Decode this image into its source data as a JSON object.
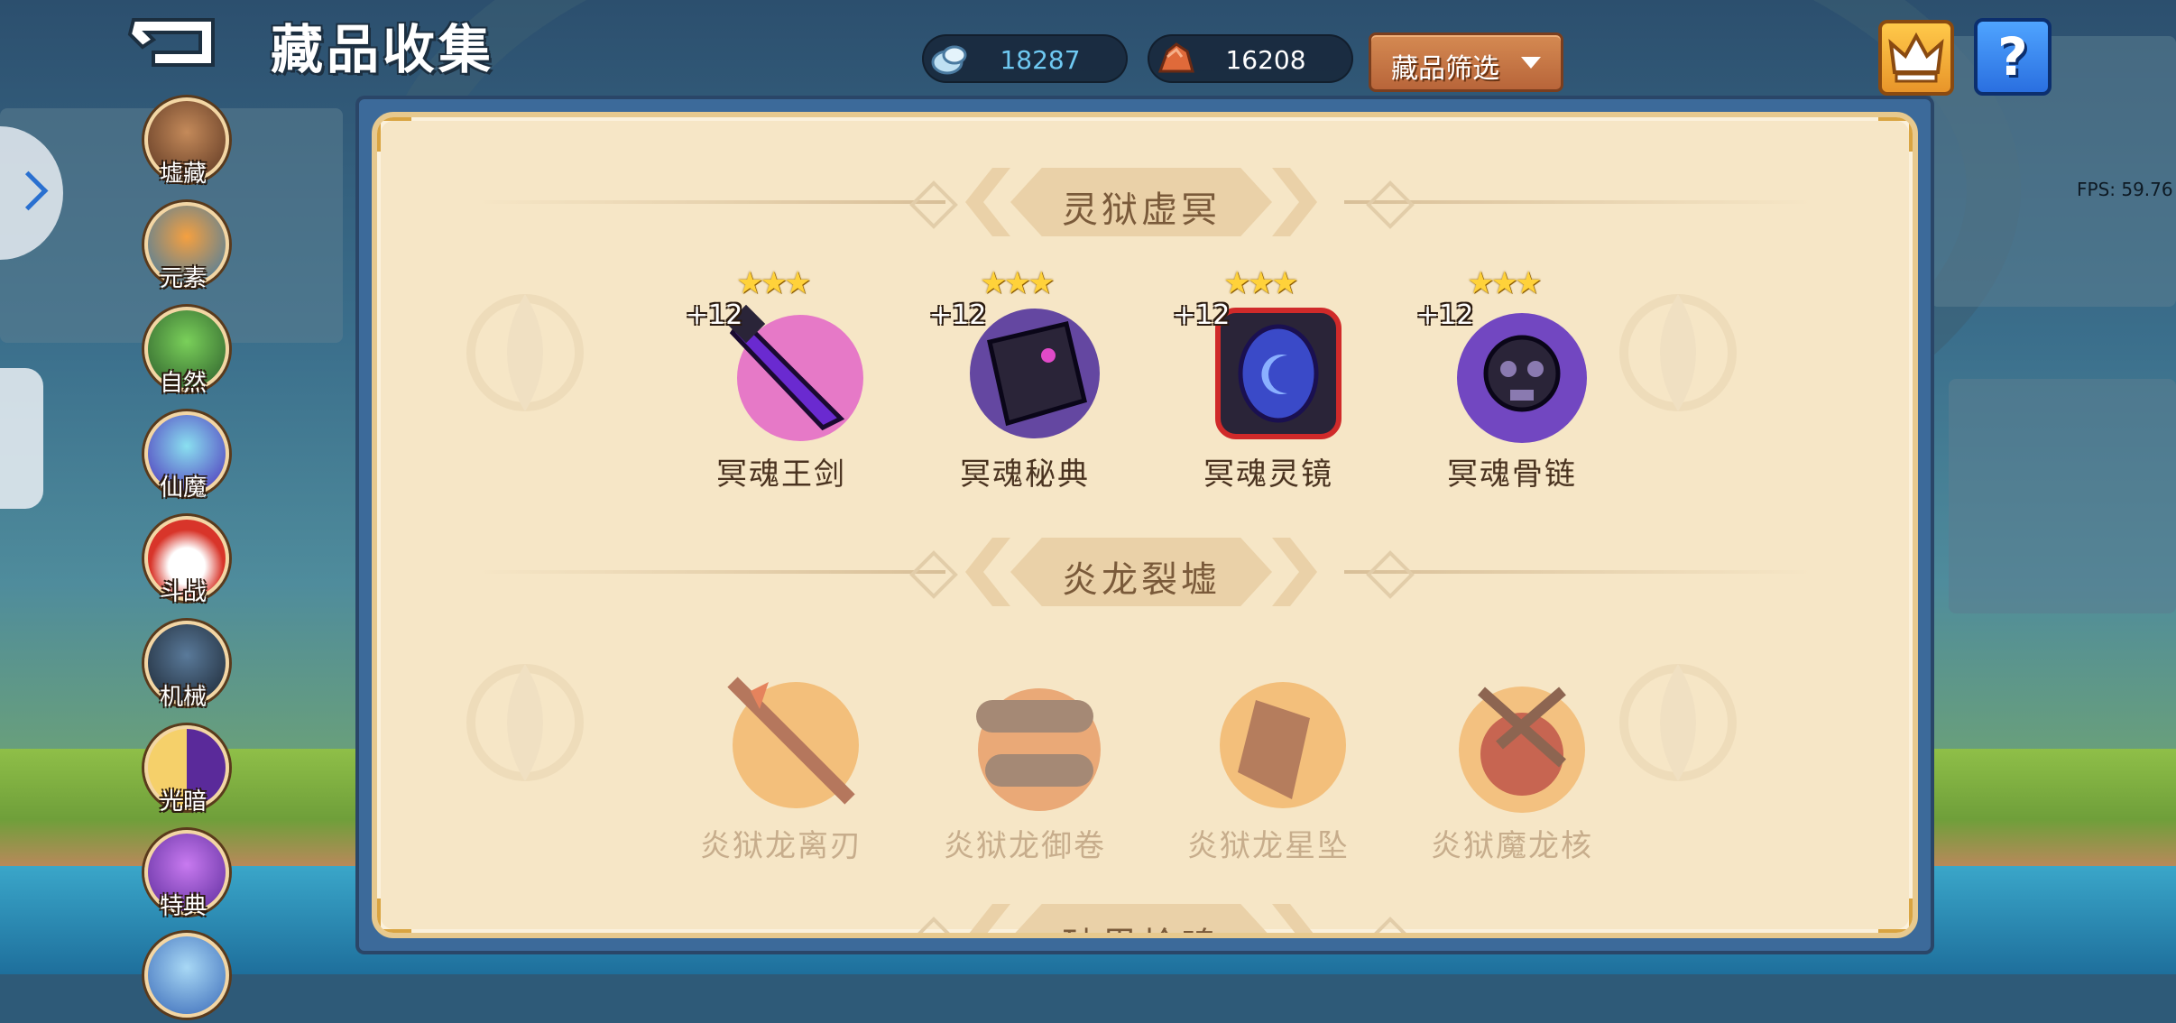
{
  "header": {
    "title": "藏品收集",
    "filter_label": "藏品筛选",
    "help_label": "?"
  },
  "resources": [
    {
      "icon": "soul-stone-icon",
      "value": "18287",
      "color": "#6fc9f2"
    },
    {
      "icon": "ore-icon",
      "value": "16208",
      "color": "#ffffff"
    }
  ],
  "debug": {
    "fps": "FPS: 59.76"
  },
  "sidebar": {
    "categories": [
      {
        "label": "墟藏",
        "icon": "ruins-chest-icon",
        "color": "#8a5a3a"
      },
      {
        "label": "元素",
        "icon": "element-flame-icon",
        "color": "#c86a3a"
      },
      {
        "label": "自然",
        "icon": "nature-tree-icon",
        "color": "#3f8a3a"
      },
      {
        "label": "仙魔",
        "icon": "immortal-demon-icon",
        "color": "#5a4ab8"
      },
      {
        "label": "斗战",
        "icon": "battle-cloud-icon",
        "color": "#c8352a"
      },
      {
        "label": "机械",
        "icon": "mech-robot-icon",
        "color": "#3a4a5a"
      },
      {
        "label": "光暗",
        "icon": "light-dark-icon",
        "color": "#7a3ab8"
      },
      {
        "label": "特典",
        "icon": "special-star-icon",
        "color": "#8a4ac8"
      },
      {
        "label": "",
        "icon": "more-category-icon",
        "color": "#5a8ac8"
      }
    ]
  },
  "sections": [
    {
      "title": "灵狱虚冥",
      "items": [
        {
          "name": "冥魂王剑",
          "level": "+12",
          "stars": "★★★",
          "icon": "soul-king-sword-icon",
          "color": "#6a2ad0",
          "accent": "#e04ac8"
        },
        {
          "name": "冥魂秘典",
          "level": "+12",
          "stars": "★★★",
          "icon": "soul-secret-tome-icon",
          "color": "#4a2a9a",
          "accent": "#2a2438"
        },
        {
          "name": "冥魂灵镜",
          "level": "+12",
          "stars": "★★★",
          "icon": "soul-spirit-mirror-icon",
          "color": "#3a2a8a",
          "accent": "#d02a2a"
        },
        {
          "name": "冥魂骨链",
          "level": "+12",
          "stars": "★★★",
          "icon": "soul-bone-chain-icon",
          "color": "#5a2ac0",
          "accent": "#2a2438"
        }
      ]
    },
    {
      "title": "炎龙裂墟",
      "items": [
        {
          "name": "炎狱龙离刃",
          "icon": "flame-dragon-blade-icon",
          "color": "#e0623a",
          "accent": "#f0a040"
        },
        {
          "name": "炎狱龙御卷",
          "icon": "flame-dragon-scroll-icon",
          "color": "#c8603a",
          "accent": "#8a6a5a"
        },
        {
          "name": "炎狱龙星坠",
          "icon": "flame-dragon-star-icon",
          "color": "#e07a2a",
          "accent": "#f0a040"
        },
        {
          "name": "炎狱魔龙核",
          "icon": "flame-demon-dragon-core-icon",
          "color": "#b83a2a",
          "accent": "#f0a040"
        }
      ]
    },
    {
      "title": "破界枪鸣",
      "items": []
    }
  ]
}
